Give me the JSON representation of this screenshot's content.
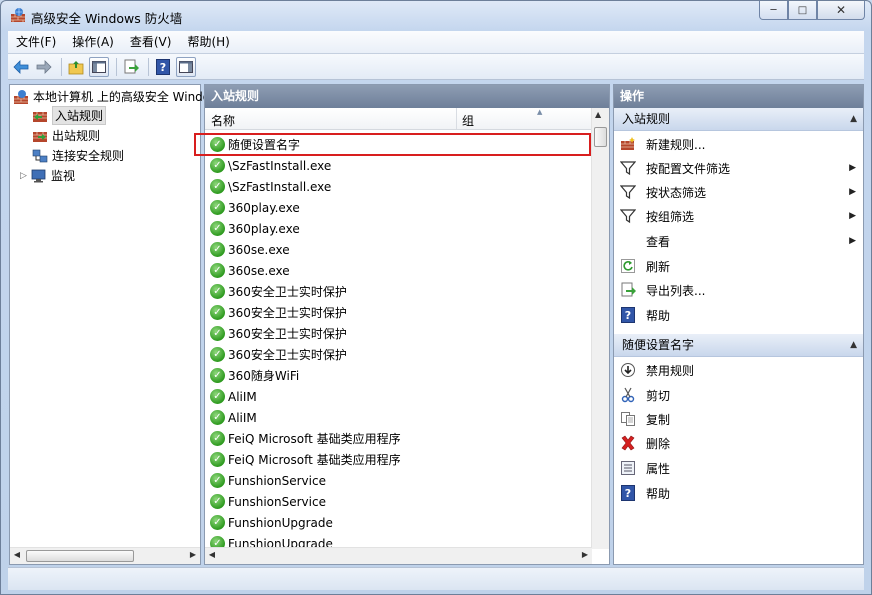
{
  "window": {
    "title": "高级安全 Windows 防火墙"
  },
  "menu": [
    "文件(F)",
    "操作(A)",
    "查看(V)",
    "帮助(H)"
  ],
  "tree": {
    "root": "本地计算机 上的高级安全 Windo",
    "items": [
      "入站规则",
      "出站规则",
      "连接安全规则",
      "监视"
    ]
  },
  "list": {
    "header": "入站规则",
    "col_name": "名称",
    "col_group": "组",
    "rows": [
      "随便设置名字",
      "\\SzFastInstall.exe",
      "\\SzFastInstall.exe",
      "360play.exe",
      "360play.exe",
      "360se.exe",
      "360se.exe",
      "360安全卫士实时保护",
      "360安全卫士实时保护",
      "360安全卫士实时保护",
      "360安全卫士实时保护",
      "360随身WiFi",
      "AliIM",
      "AliIM",
      "FeiQ Microsoft 基础类应用程序",
      "FeiQ Microsoft 基础类应用程序",
      "FunshionService",
      "FunshionService",
      "FunshionUpgrade",
      "FunshionUpgrade"
    ]
  },
  "actions": {
    "title": "操作",
    "section1": {
      "title": "入站规则",
      "items": [
        "新建规则...",
        "按配置文件筛选",
        "按状态筛选",
        "按组筛选",
        "查看",
        "刷新",
        "导出列表...",
        "帮助"
      ]
    },
    "section2": {
      "title": "随便设置名字",
      "items": [
        "禁用规则",
        "剪切",
        "复制",
        "删除",
        "属性",
        "帮助"
      ]
    }
  }
}
